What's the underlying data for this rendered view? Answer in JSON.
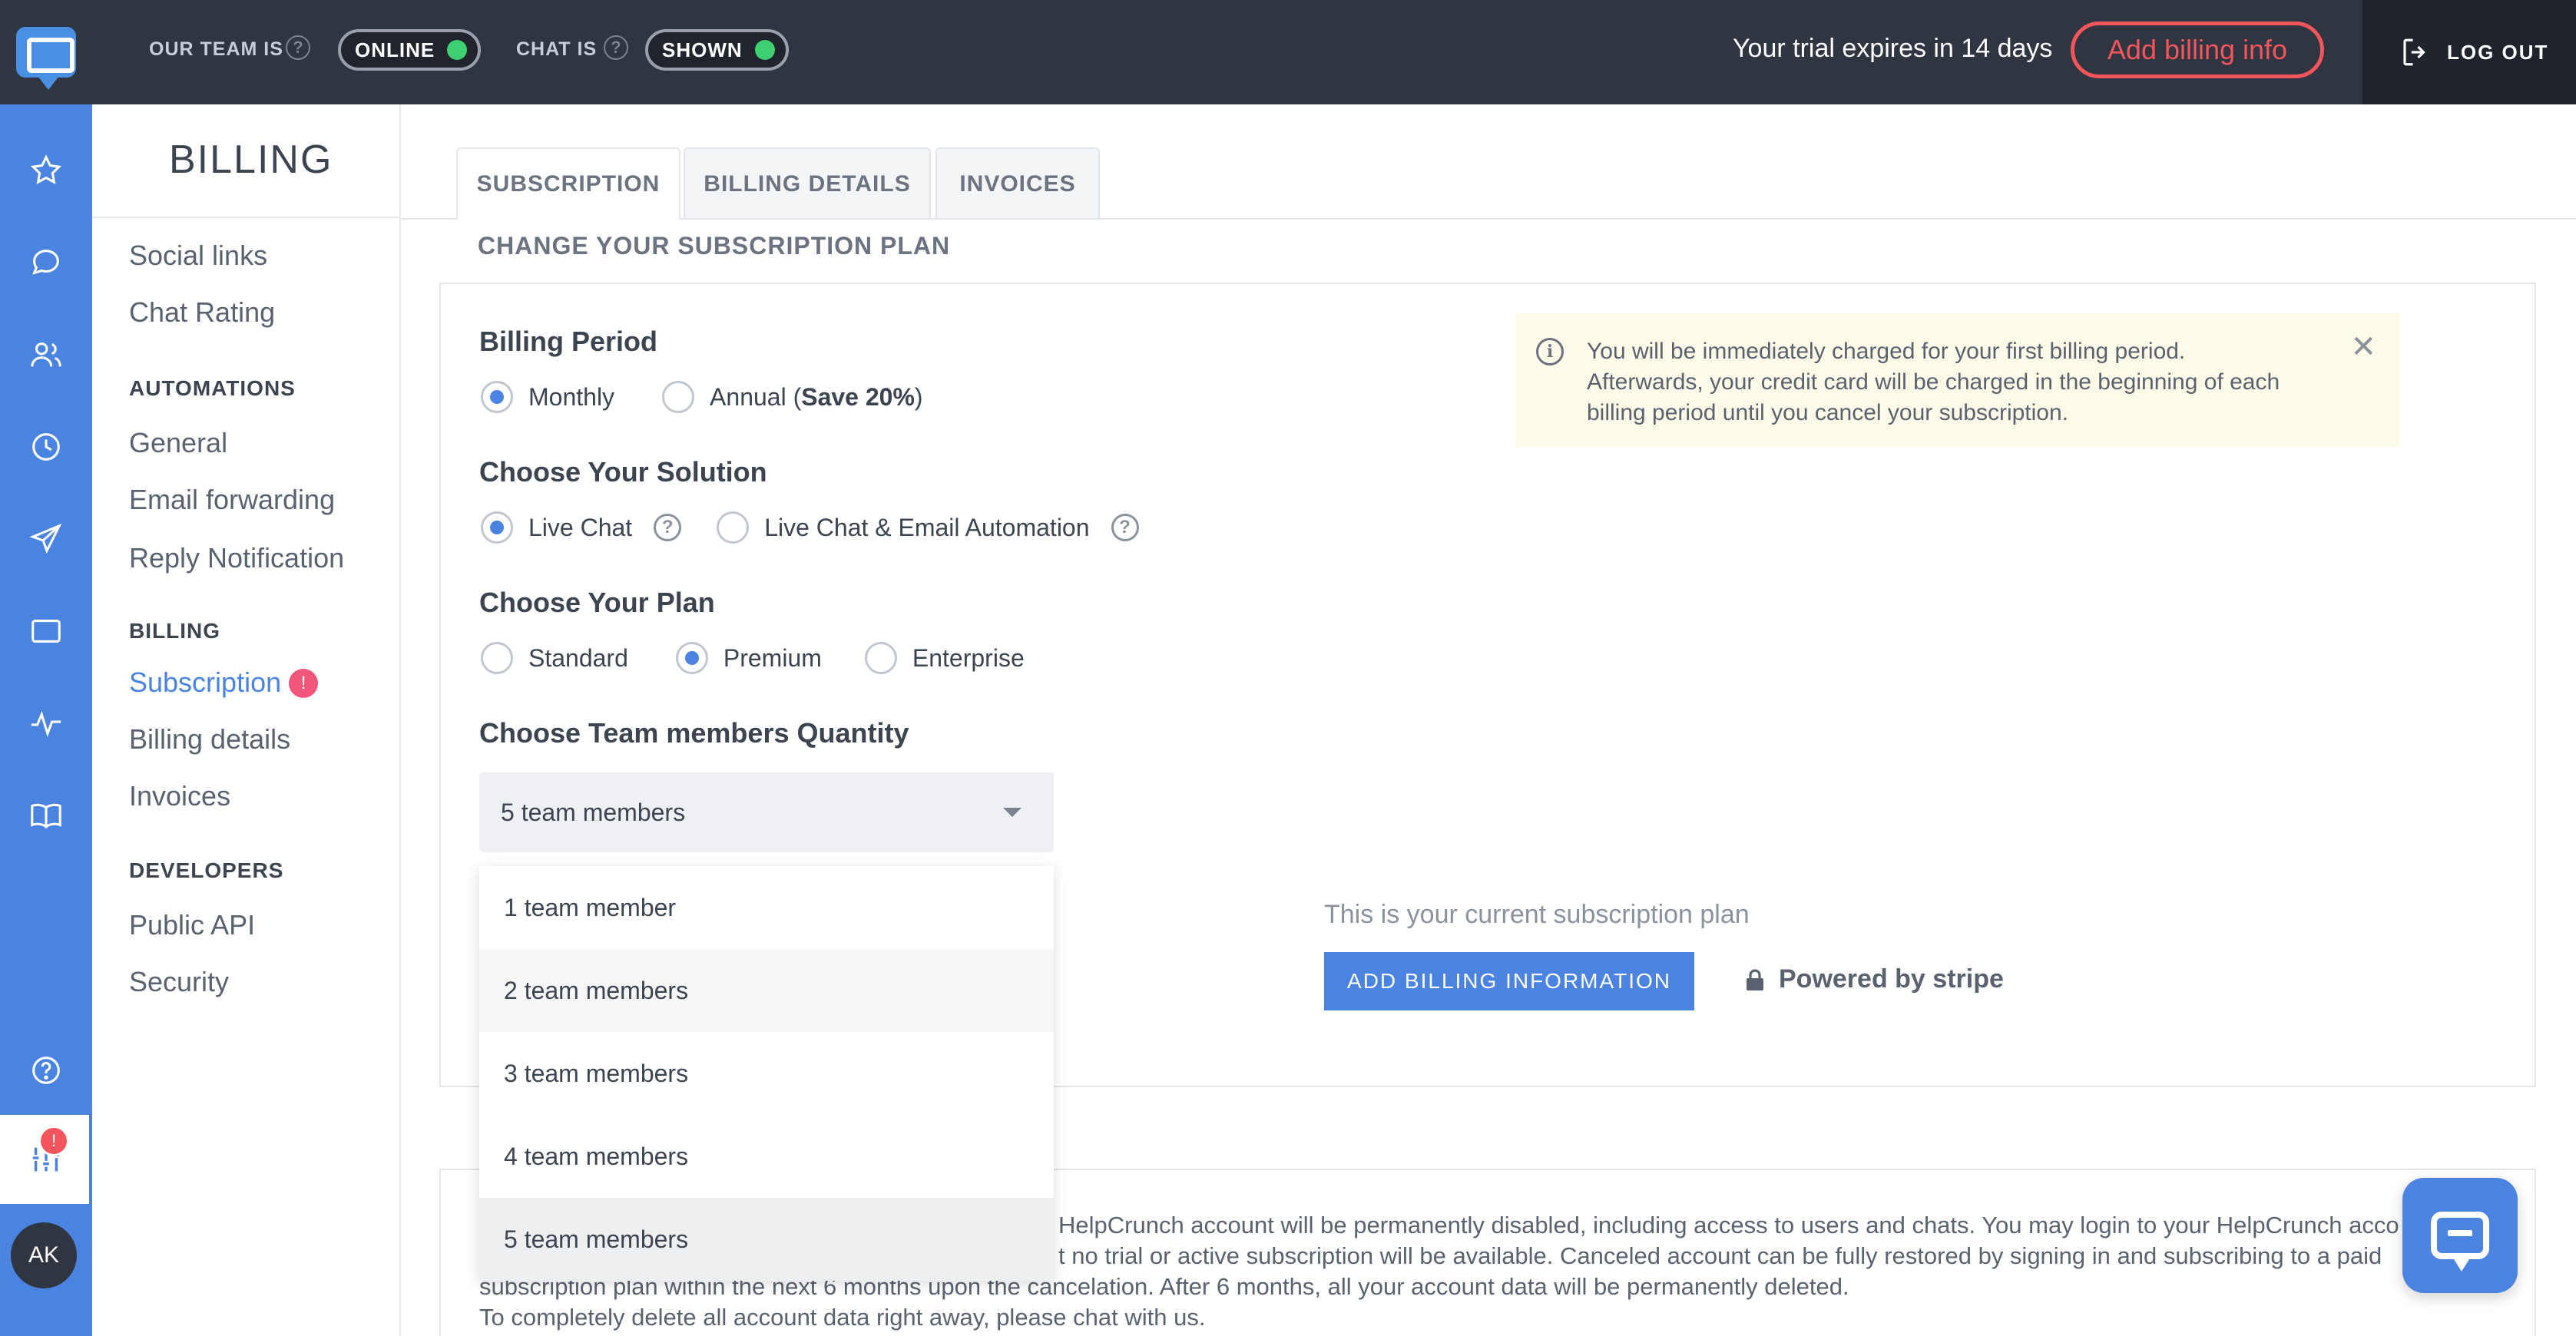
{
  "topbar": {
    "team_label": "OUR TEAM IS",
    "team_status": "ONLINE",
    "chat_label": "CHAT IS",
    "chat_status": "SHOWN",
    "trial_text": "Your trial expires in 14 days",
    "billing_button": "Add billing info",
    "logout": "LOG OUT",
    "status_color": "#3ecf73",
    "accent_red": "#f2555b"
  },
  "rail": {
    "icons": [
      "star-icon",
      "chat-bubble-icon",
      "users-icon",
      "clock-icon",
      "send-icon",
      "window-icon",
      "activity-icon",
      "book-icon",
      "help-icon",
      "settings-sliders-icon"
    ],
    "settings_badge": "!",
    "avatar_initials": "AK",
    "color": "#4a84e0"
  },
  "sidebar": {
    "title": "BILLING",
    "items_top": [
      "Social links",
      "Chat Rating"
    ],
    "automations_head": "AUTOMATIONS",
    "automations": [
      "General",
      "Email forwarding",
      "Reply Notification"
    ],
    "billing_head": "BILLING",
    "billing_items": [
      "Subscription",
      "Billing details",
      "Invoices"
    ],
    "subscription_badge": "!",
    "developers_head": "DEVELOPERS",
    "developers": [
      "Public API",
      "Security"
    ]
  },
  "tabs": [
    "SUBSCRIPTION",
    "BILLING DETAILS",
    "INVOICES"
  ],
  "main": {
    "section_title": "CHANGE YOUR SUBSCRIPTION PLAN",
    "billing_period": {
      "title": "Billing Period",
      "options": [
        "Monthly",
        "Annual ("
      ],
      "annual_bold": "Save 20%",
      "annual_close": ")",
      "selected": "Monthly"
    },
    "solution": {
      "title": "Choose Your Solution",
      "options": [
        "Live Chat",
        "Live Chat & Email Automation"
      ],
      "selected": "Live Chat"
    },
    "plan": {
      "title": "Choose Your Plan",
      "options": [
        "Standard",
        "Premium",
        "Enterprise"
      ],
      "selected": "Premium"
    },
    "team": {
      "title": "Choose Team members Quantity",
      "selected_value": "5 team members",
      "options": [
        "1 team member",
        "2 team members",
        "3 team members",
        "4 team members",
        "5 team members"
      ]
    },
    "notice": {
      "lines": [
        "You will be immediately charged for your first billing period.",
        "Afterwards, your credit card will be charged in the beginning of each",
        "billing period until you cancel your subscription."
      ]
    },
    "current_plan_text": "This is your current subscription plan",
    "add_billing_button": "ADD BILLING INFORMATION",
    "powered_by": "Powered by stripe"
  },
  "footer": {
    "line1": "HelpCrunch account will be permanently disabled, including access to users and chats. You may login to your HelpCrunch acco",
    "line2": "t no trial or active subscription will be available. Canceled account can be fully restored by signing in and subscribing to a paid",
    "line3": "subscription plan within the next 6 months upon the cancelation. After 6 months, all your account data will be permanently deleted.",
    "line4": "To completely delete all account data right away, please chat with us."
  }
}
